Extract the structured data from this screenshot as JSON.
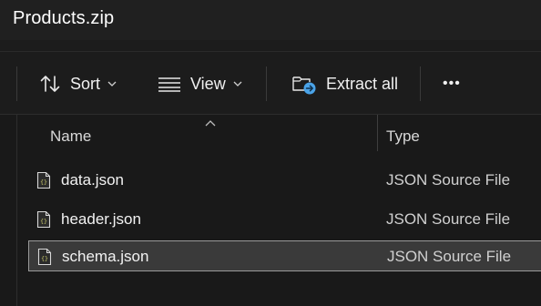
{
  "window": {
    "title": "Products.zip"
  },
  "toolbar": {
    "sort_label": "Sort",
    "view_label": "View",
    "extract_label": "Extract all",
    "more_label": "•••"
  },
  "columns": {
    "name": "Name",
    "type": "Type"
  },
  "files": [
    {
      "name": "data.json",
      "type": "JSON Source File",
      "icon": "json-file-icon",
      "selected": false
    },
    {
      "name": "header.json",
      "type": "JSON Source File",
      "icon": "json-file-icon",
      "selected": false
    },
    {
      "name": "schema.json",
      "type": "JSON Source File",
      "icon": "json-file-icon",
      "selected": true
    }
  ],
  "colors": {
    "background": "#191919",
    "selection": "#3a3a3a",
    "accent_blue": "#4aa3e8",
    "json_icon": "#c8c86a"
  }
}
